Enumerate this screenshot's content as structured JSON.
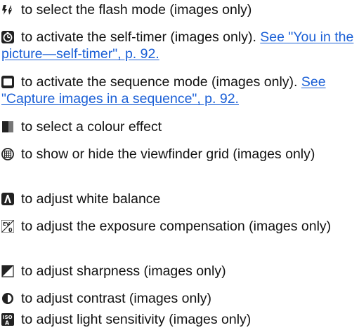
{
  "items": [
    {
      "icon": "flash-mode-icon",
      "text": "to select the flash mode (images only)"
    },
    {
      "icon": "self-timer-icon",
      "text": "to activate the self-timer (images only).",
      "link": "See \"You in the picture—self-timer\", p. 92."
    },
    {
      "icon": "sequence-mode-icon",
      "text": "to activate the sequence mode (images only).",
      "link": "See \"Capture images in a sequence\", p. 92."
    },
    {
      "icon": "colour-effect-icon",
      "text": "to select a colour effect"
    },
    {
      "icon": "viewfinder-grid-icon",
      "text": "to show or hide the viewfinder grid (images only)"
    },
    {
      "icon": "white-balance-icon",
      "text": "to adjust white balance"
    },
    {
      "icon": "exposure-compensation-icon",
      "text": "to adjust the exposure compensation (images only)"
    },
    {
      "icon": "sharpness-icon",
      "text": "to adjust sharpness (images only)"
    },
    {
      "icon": "contrast-icon",
      "text": "to adjust contrast (images only)"
    },
    {
      "icon": "light-sensitivity-icon",
      "text": "to adjust light sensitivity (images only)"
    }
  ]
}
